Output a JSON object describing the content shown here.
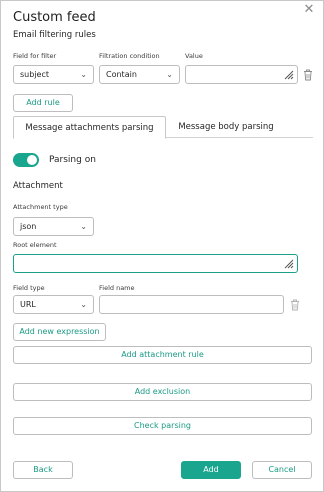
{
  "dialog": {
    "title": "Custom feed",
    "close_icon": "close-icon"
  },
  "email_filtering": {
    "heading": "Email filtering rules",
    "col_field": "Field for filter",
    "col_condition": "Filtration condition",
    "col_value": "Value",
    "field_value": "subject",
    "condition_value": "Contain",
    "value_text": "",
    "add_rule_label": "Add rule"
  },
  "tabs": [
    {
      "label": "Message attachments parsing",
      "active": true
    },
    {
      "label": "Message body parsing",
      "active": false
    }
  ],
  "parsing": {
    "toggle_label": "Parsing on",
    "toggle_on": true,
    "attachment_heading": "Attachment",
    "attachment_type_label": "Attachment type",
    "attachment_type_value": "json",
    "root_element_label": "Root element",
    "root_element_value": "",
    "field_type_label": "Field type",
    "field_type_value": "URL",
    "field_name_label": "Field name",
    "field_name_value": "",
    "add_expression_label": "Add new expression",
    "add_attachment_rule_label": "Add attachment rule",
    "add_exclusion_label": "Add exclusion",
    "check_parsing_label": "Check parsing"
  },
  "footer": {
    "back_label": "Back",
    "add_label": "Add",
    "cancel_label": "Cancel"
  },
  "colors": {
    "accent": "#1aa58e",
    "border": "#bdbdbd"
  }
}
